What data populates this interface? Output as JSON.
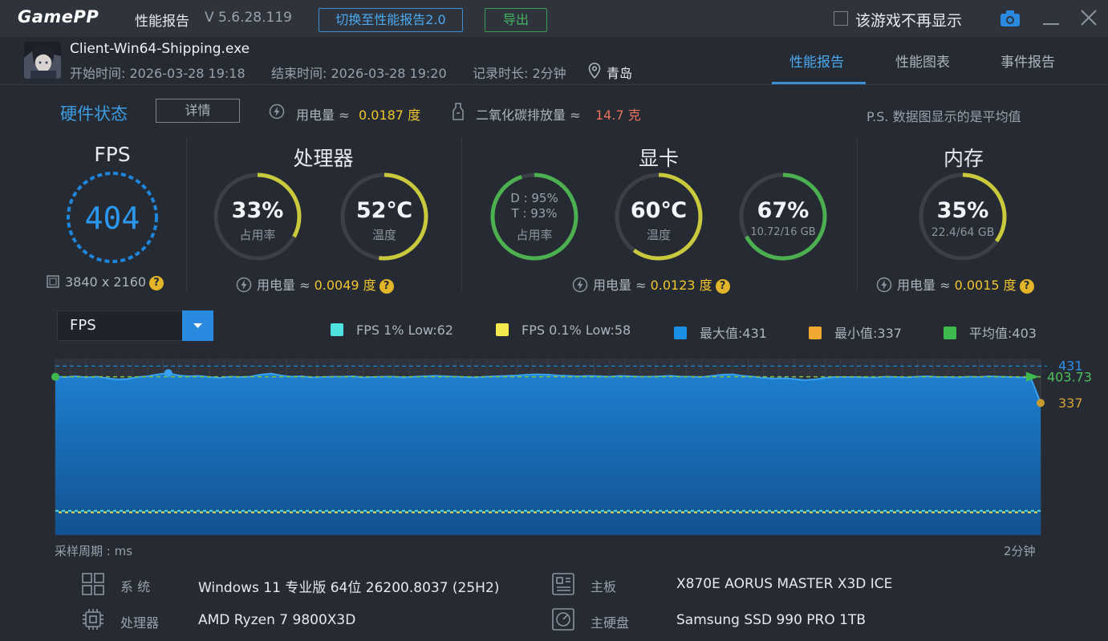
{
  "titlebar": {
    "logo": "GamePP",
    "app_title": "性能报告",
    "version": "V 5.6.28.119",
    "switch_button": "切换至性能报告2.0",
    "export_button": "导出",
    "hide_game_label": "该游戏不再显示",
    "hide_game_checked": false
  },
  "session": {
    "exe_name": "Client-Win64-Shipping.exe",
    "start": "开始时间: 2026-03-28 19:18",
    "end": "结束时间: 2026-03-28 19:20",
    "duration": "记录时长: 2分钟",
    "city": "青岛"
  },
  "tabs": [
    {
      "label": "性能报告",
      "active": true
    },
    {
      "label": "性能图表",
      "active": false
    },
    {
      "label": "事件报告",
      "active": false
    }
  ],
  "hardware": {
    "title": "硬件状态",
    "details_button": "详情",
    "power_label": "用电量 ≈",
    "power_value": "0.0187 度",
    "co2_label": "二氧化碳排放量 ≈",
    "co2_value": "14.7 克",
    "note": "P.S. 数据图显示的是平均值"
  },
  "fps_card": {
    "title": "FPS",
    "value": "404",
    "resolution": "3840 x 2160"
  },
  "cpu_card": {
    "title": "处理器",
    "usage": {
      "main": "33%",
      "sub": "占用率",
      "fraction": 0.33
    },
    "temp": {
      "main": "52℃",
      "sub": "温度",
      "fraction": 0.52
    },
    "power_label": "用电量 ≈",
    "power_value": "0.0049 度"
  },
  "gpu_card": {
    "title": "显卡",
    "usage": {
      "line1": "D : 95%",
      "line2": "T : 93%",
      "sub": "占用率",
      "fraction": 0.95
    },
    "temp": {
      "main": "60℃",
      "sub": "温度",
      "fraction": 0.6
    },
    "vram": {
      "main": "67%",
      "sub": "10.72/16 GB",
      "fraction": 0.67
    },
    "power_label": "用电量 ≈",
    "power_value": "0.0123 度"
  },
  "mem_card": {
    "title": "内存",
    "usage": {
      "main": "35%",
      "sub": "22.4/64 GB",
      "fraction": 0.35
    },
    "power_label": "用电量 ≈",
    "power_value": "0.0015 度"
  },
  "chart_controls": {
    "metric": "FPS",
    "legend": [
      {
        "label": "FPS 1% Low:62",
        "color": "#4fe3e0"
      },
      {
        "label": "FPS 0.1% Low:58",
        "color": "#f2e94e"
      },
      {
        "label": "最大值:431",
        "color": "#1a8fe3"
      },
      {
        "label": "最小值:337",
        "color": "#f0a830"
      },
      {
        "label": "平均值:403",
        "color": "#3fba4f"
      }
    ],
    "sample_period": "采样周期 : ms",
    "x_end_label": "2分钟"
  },
  "chart_data": {
    "type": "area",
    "series": [
      {
        "name": "FPS",
        "values": [
          404,
          403,
          405,
          402,
          404,
          400,
          397,
          398,
          403,
          405,
          410,
          413,
          407,
          405,
          406,
          403,
          401,
          404,
          403,
          404,
          409,
          412,
          407,
          404,
          405,
          402,
          403,
          404,
          404,
          405,
          402,
          403,
          404,
          404,
          402,
          404,
          405,
          406,
          405,
          404,
          403,
          402,
          404,
          405,
          406,
          407,
          409,
          410,
          409,
          407,
          406,
          405,
          406,
          405,
          404,
          406,
          405,
          404,
          404,
          405,
          406,
          404,
          404,
          403,
          406,
          409,
          410,
          406,
          404,
          401,
          399,
          400,
          398,
          395,
          397,
          401,
          403,
          403,
          403,
          402,
          402,
          404,
          403,
          402,
          404,
          405,
          403,
          403,
          402,
          404,
          403,
          405,
          404,
          403,
          402,
          404,
          337
        ]
      }
    ],
    "one_percent_low": 62,
    "point_one_percent_low": 58,
    "max": 431,
    "min": 337,
    "avg": 403.73,
    "max_label": "431",
    "min_label": "337",
    "avg_label": "403.73",
    "ylim": [
      0,
      450
    ]
  },
  "system_info": [
    {
      "label": "系  统",
      "value": "Windows 11 专业版 64位 26200.8037 (25H2)"
    },
    {
      "label": "主板",
      "value": "X870E AORUS MASTER X3D ICE"
    },
    {
      "label": "处理器",
      "value": "AMD Ryzen 7 9800X3D"
    },
    {
      "label": "主硬盘",
      "value": "Samsung SSD 990 PRO 1TB"
    }
  ],
  "colors": {
    "accent_blue": "#3a8fd6",
    "gauge_yellow": "#c8c93c",
    "gauge_green": "#4caf50",
    "gauge_track": "#3a3f48",
    "value_yellow": "#f0c52e",
    "co2_red": "#e8735a"
  }
}
